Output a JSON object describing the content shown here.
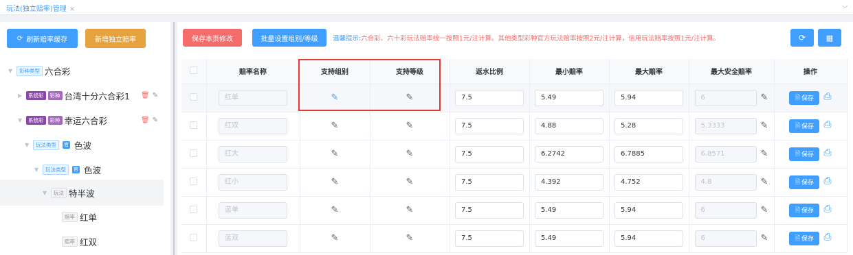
{
  "tab": {
    "label": "玩法(独立赔率)管理",
    "close": "×",
    "caret": "⌵"
  },
  "left": {
    "refresh_label": "刷新赔率缓存",
    "add_label": "新增独立赔率",
    "tree": [
      {
        "tag1": "彩种类型",
        "label": "六合彩"
      },
      {
        "tag1": "系统彩",
        "tag2": "彩种",
        "label": "台湾十分六合彩1"
      },
      {
        "tag1": "系统彩",
        "tag2": "彩种",
        "label": "幸运六合彩"
      },
      {
        "tag1": "玩法类型",
        "mini": "官",
        "label": "色波"
      },
      {
        "tag1": "玩法类型",
        "mini": "官",
        "label": "色波"
      },
      {
        "tag1": "玩法",
        "label": "特半波"
      },
      {
        "tag1": "赔率",
        "label": "红单"
      },
      {
        "tag1": "赔率",
        "label": "红双"
      }
    ]
  },
  "toolbar": {
    "save_page": "保存本页修改",
    "batch": "批量设置组别/等级",
    "tip_label": "温馨提示:",
    "tip_text": "六合彩、六十彩玩法赔率统一按照1元/注计算。其他类型彩种官方玩法赔率按照2元/注计算，信用玩法赔率按照1元/注计算。"
  },
  "table": {
    "headers": [
      "赔率名称",
      "支持组别",
      "支持等级",
      "返水比例",
      "最小赔率",
      "最大赔率",
      "最大安全赔率",
      "操作"
    ],
    "save_label": "保存",
    "rows": [
      {
        "name": "红单",
        "rebate": "7.5",
        "min": "5.49",
        "max": "5.94",
        "safe": "6"
      },
      {
        "name": "红双",
        "rebate": "7.5",
        "min": "4.88",
        "max": "5.28",
        "safe": "5.3333"
      },
      {
        "name": "红大",
        "rebate": "7.5",
        "min": "6.2742",
        "max": "6.7885",
        "safe": "6.8571"
      },
      {
        "name": "红小",
        "rebate": "7.5",
        "min": "4.392",
        "max": "4.752",
        "safe": "4.8"
      },
      {
        "name": "蓝单",
        "rebate": "7.5",
        "min": "5.49",
        "max": "5.94",
        "safe": "6"
      },
      {
        "name": "蓝双",
        "rebate": "7.5",
        "min": "5.49",
        "max": "5.94",
        "safe": "6"
      }
    ]
  },
  "colors": {
    "primary": "#409eff",
    "warning": "#e6a23c",
    "danger": "#f56c6c",
    "highlight_box": "#e53935"
  }
}
